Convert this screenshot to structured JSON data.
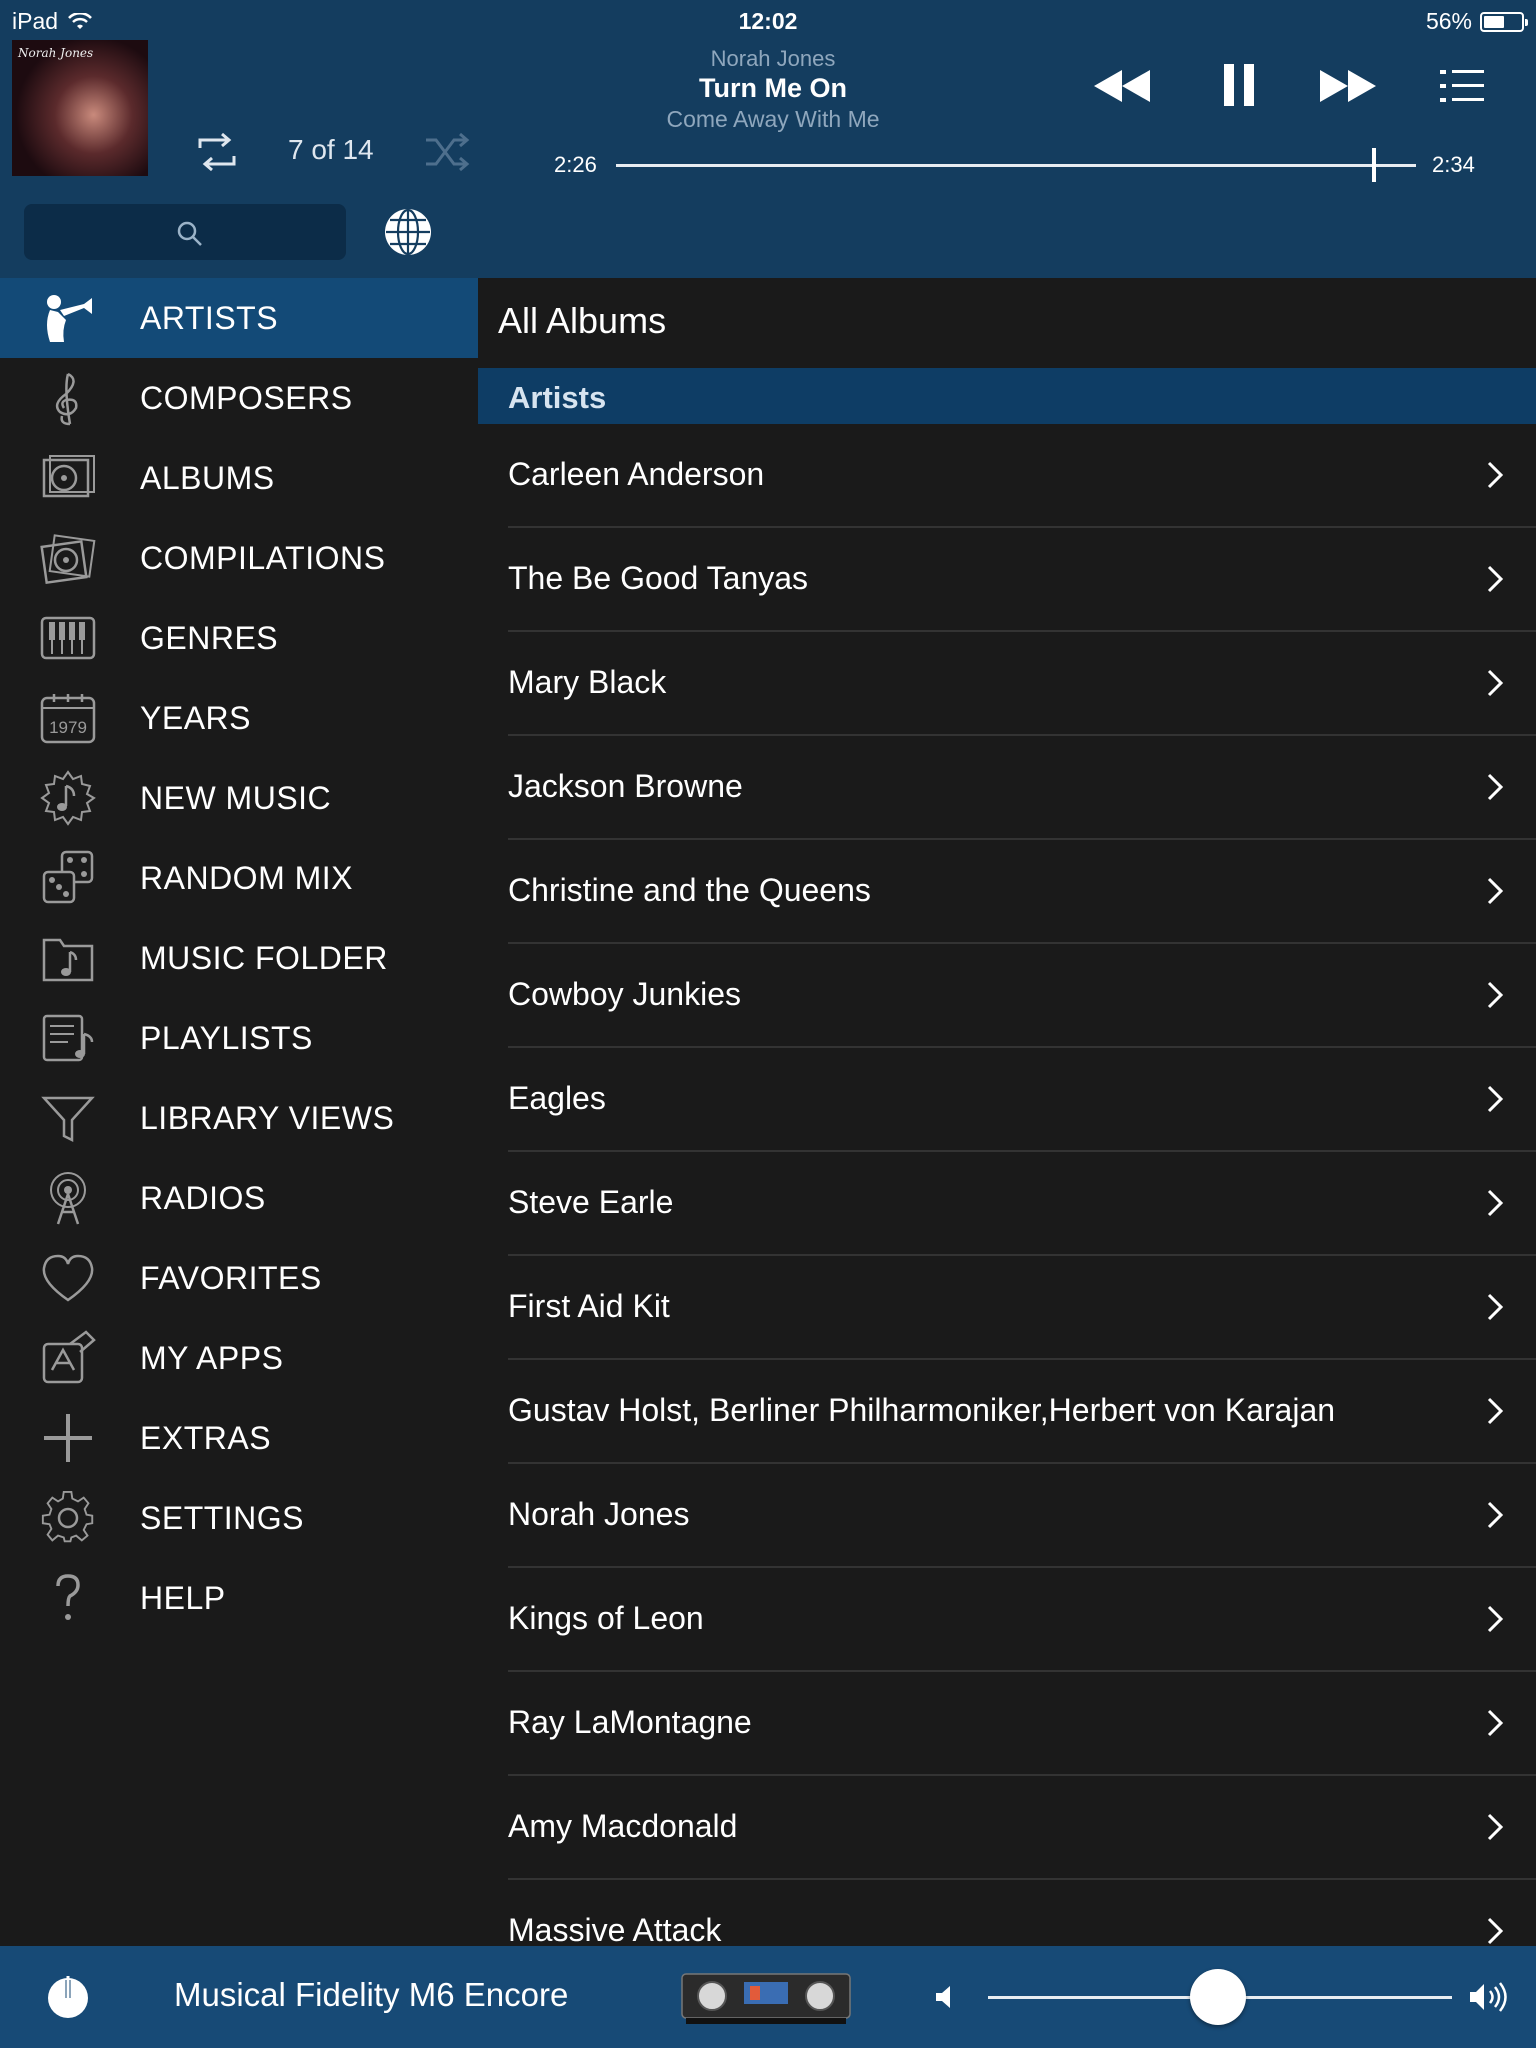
{
  "status_bar": {
    "device": "iPad",
    "time": "12:02",
    "battery": "56%",
    "battery_level": 0.56
  },
  "now_playing": {
    "artist": "Norah Jones",
    "title": "Turn Me On",
    "album": "Come Away With Me",
    "track_position": "7 of 14",
    "elapsed": "2:26",
    "duration": "2:34",
    "progress": 0.948,
    "album_art_signature": "Norah Jones"
  },
  "header": {
    "search_icon": "search-icon",
    "globe_icon": "globe-icon"
  },
  "sidebar": {
    "items": [
      {
        "label": "ARTISTS",
        "icon": "trumpet-player-icon",
        "active": true
      },
      {
        "label": "COMPOSERS",
        "icon": "treble-clef-icon"
      },
      {
        "label": "ALBUMS",
        "icon": "album-icon"
      },
      {
        "label": "COMPILATIONS",
        "icon": "compilation-icon"
      },
      {
        "label": "GENRES",
        "icon": "piano-keys-icon"
      },
      {
        "label": "YEARS",
        "icon": "calendar-icon"
      },
      {
        "label": "NEW MUSIC",
        "icon": "new-music-badge-icon"
      },
      {
        "label": "RANDOM MIX",
        "icon": "dice-icon"
      },
      {
        "label": "MUSIC FOLDER",
        "icon": "music-folder-icon"
      },
      {
        "label": "PLAYLISTS",
        "icon": "playlist-icon"
      },
      {
        "label": "LIBRARY VIEWS",
        "icon": "funnel-icon"
      },
      {
        "label": "RADIOS",
        "icon": "radio-tower-icon"
      },
      {
        "label": "FAVORITES",
        "icon": "heart-icon"
      },
      {
        "label": "MY APPS",
        "icon": "apps-icon"
      },
      {
        "label": "EXTRAS",
        "icon": "plus-icon"
      },
      {
        "label": "SETTINGS",
        "icon": "gear-icon"
      },
      {
        "label": "HELP",
        "icon": "question-icon"
      }
    ],
    "calendar_year": "1979"
  },
  "main": {
    "title": "All Albums",
    "section": "Artists",
    "artists": [
      "Carleen Anderson",
      "The Be Good Tanyas",
      "Mary Black",
      "Jackson Browne",
      "Christine and the Queens",
      "Cowboy Junkies",
      "Eagles",
      "Steve Earle",
      "First Aid Kit",
      "Gustav Holst, Berliner Philharmoniker,Herbert von Karajan",
      "Norah Jones",
      "Kings of Leon",
      "Ray LaMontagne",
      "Amy Macdonald",
      "Massive Attack"
    ]
  },
  "footer": {
    "device_name": "Musical Fidelity M6 Encore",
    "volume": 0.495
  },
  "colors": {
    "header_bg": "#143d5f",
    "active_nav": "#134a77",
    "section_header": "#0e3d65",
    "footer_bg": "#174a76",
    "list_bg": "#1a1a1a"
  }
}
